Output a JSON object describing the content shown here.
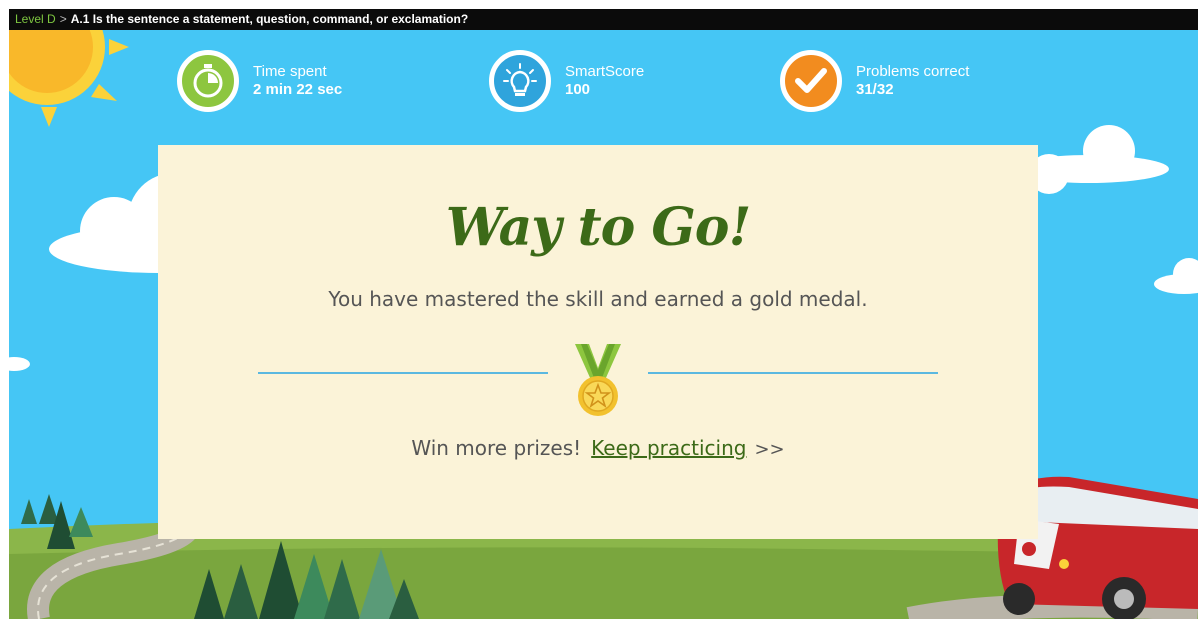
{
  "breadcrumb": {
    "level": "Level D",
    "separator": ">",
    "skill": "A.1 Is the sentence a statement, question, command, or exclamation?"
  },
  "stats": {
    "time": {
      "label": "Time spent",
      "value": "2 min 22 sec",
      "icon": "stopwatch-icon",
      "color": "#8dc63f"
    },
    "smartscore": {
      "label": "SmartScore",
      "value": "100",
      "icon": "lightbulb-icon",
      "color": "#2fa4dc"
    },
    "problems": {
      "label": "Problems correct",
      "value": "31/32",
      "icon": "checkmark-icon",
      "color": "#f28c1f"
    }
  },
  "card": {
    "headline": "Way to Go!",
    "message": "You have mastered the skill and earned a gold medal.",
    "prize_text": "Win more prizes!",
    "link_label": "Keep practicing",
    "arrows": ">>"
  },
  "colors": {
    "sky": "#45c6f5",
    "grass": "#8bb64a",
    "card": "#fbf3d8",
    "headline": "#3c6a18",
    "rule": "#5bb8e0"
  }
}
